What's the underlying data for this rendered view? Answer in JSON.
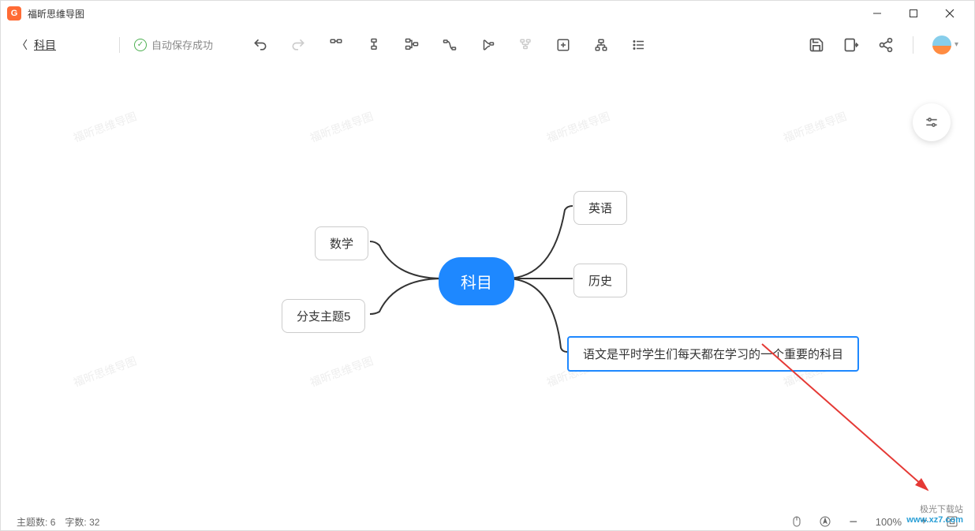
{
  "app": {
    "title": "福昕思维导图"
  },
  "header": {
    "back_label": "科目",
    "save_status": "自动保存成功"
  },
  "mindmap": {
    "root": "科目",
    "left_nodes": [
      "数学",
      "分支主题5"
    ],
    "right_nodes": [
      "英语",
      "历史",
      "语文是平时学生们每天都在学习的一个重要的科目"
    ]
  },
  "watermark_text": "福昕思维导图",
  "statusbar": {
    "topic_label": "主题数:",
    "topic_count": "6",
    "word_label": "字数:",
    "word_count": "32",
    "zoom": "100%"
  },
  "site": {
    "cn": "极光下载站",
    "url": "www.xz7.com"
  }
}
